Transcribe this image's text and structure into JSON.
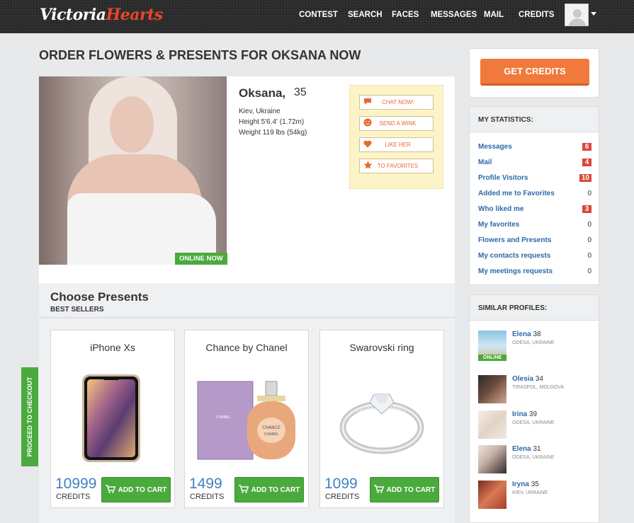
{
  "header": {
    "logo_first": "Victoria",
    "logo_second": "Hearts",
    "nav": [
      "CONTEST",
      "SEARCH",
      "FACES",
      "MESSAGES",
      "MAIL",
      "CREDITS"
    ]
  },
  "page_title": "ORDER FLOWERS & PRESENTS FOR OKSANA NOW",
  "profile": {
    "name": "Oksana,",
    "age": "35",
    "location": "Kiev, Ukraine",
    "height": "Height 5'6.4' (1.72m)",
    "weight": "Weight 119 lbs (54kg)",
    "online": "ONLINE NOW",
    "actions": [
      {
        "label": "CHAT NOW!",
        "icon": "chat-icon"
      },
      {
        "label": "SEND A WINK",
        "icon": "wink-icon"
      },
      {
        "label": "LIKE HER",
        "icon": "heart-icon"
      },
      {
        "label": "TO FAVORITES",
        "icon": "star-icon"
      }
    ]
  },
  "presents": {
    "title": "Choose Presents",
    "subtitle": "BEST SELLERS",
    "items": [
      {
        "name": "iPhone Xs",
        "price": "10999",
        "unit": "CREDITS",
        "cart": "ADD TO CART"
      },
      {
        "name": "Chance by Chanel",
        "price": "1499",
        "unit": "CREDITS",
        "cart": "ADD TO CART"
      },
      {
        "name": "Swarovski ring",
        "price": "1099",
        "unit": "CREDITS",
        "cart": "ADD TO CART"
      }
    ],
    "chanel_label_top": "CHANEL",
    "chanel_label_mid": "CHANCE",
    "chanel_label_bot": "CHANEL"
  },
  "checkout_tab": "PROCEED TO CHECKOUT",
  "sidebar": {
    "get_credits": "GET CREDITS",
    "stats_title": "MY STATISTICS:",
    "stats": [
      {
        "label": "Messages",
        "count": "6",
        "highlight": true
      },
      {
        "label": "Mail",
        "count": "4",
        "highlight": true
      },
      {
        "label": "Profile Visitors",
        "count": "10",
        "highlight": true
      },
      {
        "label": "Added me to Favorites",
        "count": "0",
        "highlight": false
      },
      {
        "label": "Who liked me",
        "count": "3",
        "highlight": true
      },
      {
        "label": "My favorites",
        "count": "0",
        "highlight": false
      },
      {
        "label": "Flowers and Presents",
        "count": "0",
        "highlight": false
      },
      {
        "label": "My contacts requests",
        "count": "0",
        "highlight": false
      },
      {
        "label": "My meetings requests",
        "count": "0",
        "highlight": false
      }
    ],
    "similar_title": "SIMILAR PROFILES:",
    "similar": [
      {
        "name": "Elena",
        "age": "38",
        "location": "ODESA, UKRAINE",
        "online": "ONLINE"
      },
      {
        "name": "Olesia",
        "age": "34",
        "location": "TIRASPOL, MOLDOVA"
      },
      {
        "name": "Irina",
        "age": "39",
        "location": "ODESA, UKRAINE"
      },
      {
        "name": "Elena",
        "age": "31",
        "location": "ODESA, UKRAINE"
      },
      {
        "name": "Iryna",
        "age": "35",
        "location": "KIEV, UKRAINE"
      }
    ]
  }
}
